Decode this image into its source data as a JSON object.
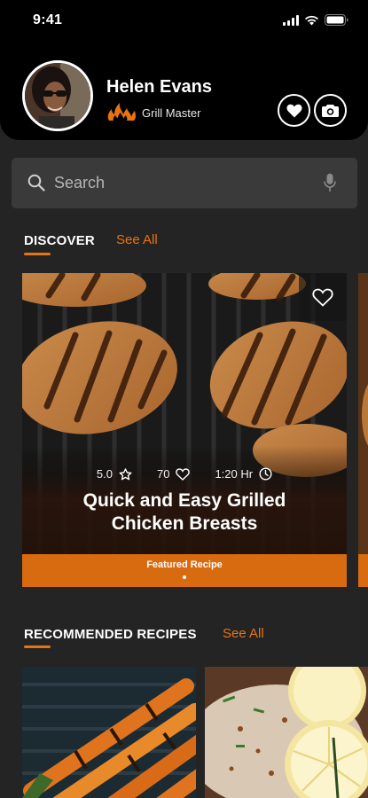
{
  "status_bar": {
    "time": "9:41"
  },
  "header": {
    "user_name": "Helen Evans",
    "user_title": "Grill Master"
  },
  "search": {
    "placeholder": "Search"
  },
  "discover": {
    "title": "DISCOVER",
    "see_all": "See All",
    "featured": {
      "rating": "5.0",
      "likes": "70",
      "duration": "1:20 Hr",
      "title": "Quick and Easy Grilled Chicken Breasts",
      "label": "Featured Recipe"
    }
  },
  "recommended": {
    "title": "RECOMMENDED RECIPES",
    "see_all": "See All"
  },
  "colors": {
    "accent": "#e9730f",
    "background": "#242424",
    "header": "#000000",
    "search_bg": "#3a3a3a"
  },
  "icons": [
    "signal-icon",
    "wifi-icon",
    "battery-icon",
    "flame-icon",
    "heart-icon",
    "camera-icon",
    "search-icon",
    "microphone-icon",
    "star-icon",
    "clock-icon"
  ]
}
